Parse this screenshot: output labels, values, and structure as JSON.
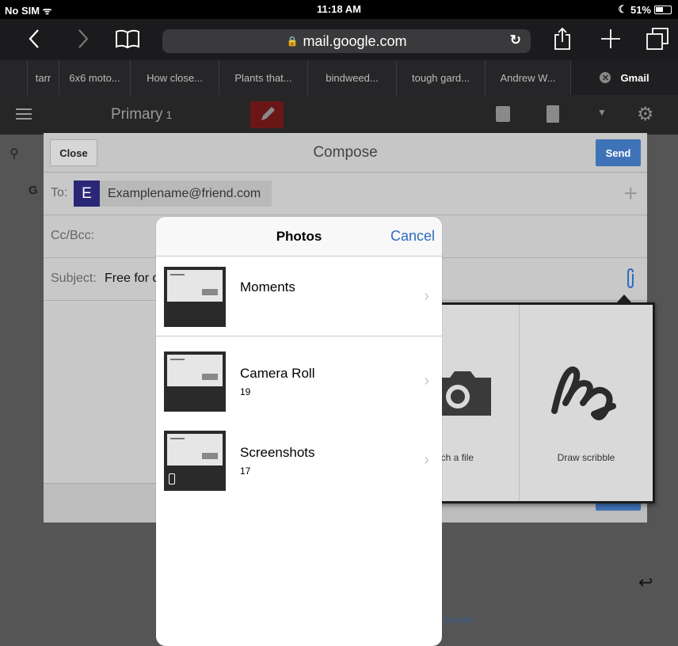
{
  "status_bar": {
    "carrier": "No SIM",
    "time": "11:18 AM",
    "battery": "51%"
  },
  "toolbar": {
    "url": "mail.google.com"
  },
  "tabs": [
    {
      "label": "tarr",
      "width": 40
    },
    {
      "label": "6x6 moto...",
      "width": 90
    },
    {
      "label": "How close...",
      "width": 112
    },
    {
      "label": "Plants that...",
      "width": 112
    },
    {
      "label": "bindweed...",
      "width": 112
    },
    {
      "label": "tough gard...",
      "width": 112
    },
    {
      "label": "Andrew W...",
      "width": 108
    },
    {
      "label": "Gmail",
      "width": 112,
      "active": true
    }
  ],
  "gmail": {
    "folder": "Primary",
    "folder_count": "1",
    "sender_initial": "G",
    "details_link": "Details"
  },
  "compose": {
    "close_label": "Close",
    "title": "Compose",
    "send_label": "Send",
    "to_label": "To:",
    "recipient_initial": "E",
    "recipient": "Examplename@friend.com",
    "ccbcc_label": "Cc/Bcc:",
    "subject_label": "Subject:",
    "subject_value": "Free for d"
  },
  "attach_menu": {
    "attach_label": "ach a file",
    "scribble_label": "Draw scribble"
  },
  "photos": {
    "title": "Photos",
    "cancel_label": "Cancel",
    "albums": [
      {
        "name": "Moments",
        "count": ""
      },
      {
        "name": "Camera Roll",
        "count": "19"
      },
      {
        "name": "Screenshots",
        "count": "17"
      }
    ]
  },
  "colors": {
    "accent": "#2f6bc2",
    "send": "#3f73b8",
    "avatar": "#2a2876"
  }
}
